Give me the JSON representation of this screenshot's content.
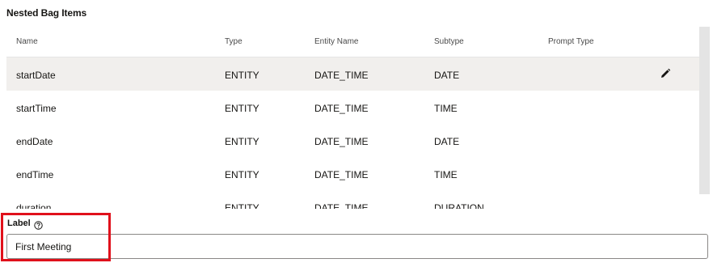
{
  "section": {
    "title": "Nested Bag Items"
  },
  "table": {
    "columns": [
      "Name",
      "Type",
      "Entity Name",
      "Subtype",
      "Prompt Type"
    ],
    "rows": [
      {
        "name": "startDate",
        "type": "ENTITY",
        "entity_name": "DATE_TIME",
        "subtype": "DATE",
        "prompt_type": ""
      },
      {
        "name": "startTime",
        "type": "ENTITY",
        "entity_name": "DATE_TIME",
        "subtype": "TIME",
        "prompt_type": ""
      },
      {
        "name": "endDate",
        "type": "ENTITY",
        "entity_name": "DATE_TIME",
        "subtype": "DATE",
        "prompt_type": ""
      },
      {
        "name": "endTime",
        "type": "ENTITY",
        "entity_name": "DATE_TIME",
        "subtype": "TIME",
        "prompt_type": ""
      },
      {
        "name": "duration",
        "type": "ENTITY",
        "entity_name": "DATE_TIME",
        "subtype": "DURATION",
        "prompt_type": ""
      }
    ],
    "row_actions": {
      "edit_icon": "pencil-icon"
    }
  },
  "label_field": {
    "label": "Label",
    "help_icon": "help-circle-icon",
    "value": "First Meeting"
  },
  "colors": {
    "highlight": "#e0101b",
    "hover_row": "#f1efed",
    "scrollbar": "#e4e4e4"
  }
}
